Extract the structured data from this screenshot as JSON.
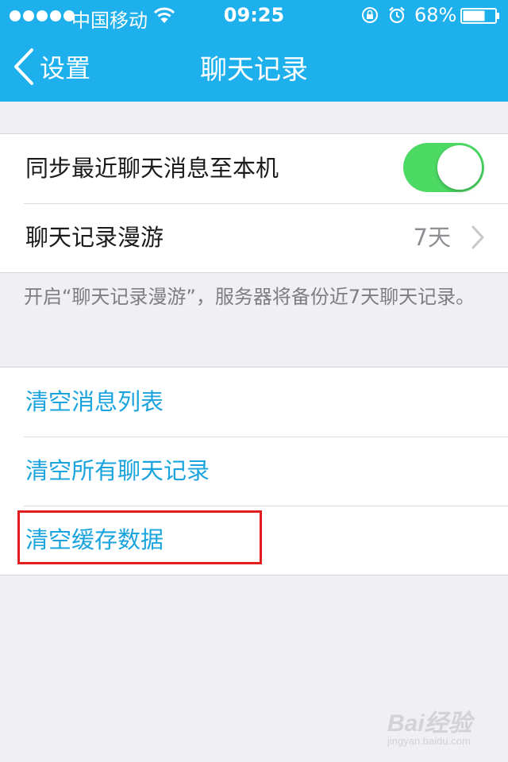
{
  "status_bar": {
    "carrier": "中国移动",
    "time": "09:25",
    "battery": "68%"
  },
  "nav": {
    "back_label": "设置",
    "title": "聊天记录"
  },
  "settings": {
    "sync_label": "同步最近聊天消息至本机",
    "sync_enabled": true,
    "roaming_label": "聊天记录漫游",
    "roaming_value": "7天",
    "roaming_note": "开启“聊天记录漫游”，服务器将备份近7天聊天记录。"
  },
  "actions": {
    "clear_list": "清空消息列表",
    "clear_all_chats": "清空所有聊天记录",
    "clear_cache": "清空缓存数据"
  },
  "watermark": {
    "brand": "Bai经验",
    "url": "jingyan.baidu.com"
  },
  "colors": {
    "header": "#1eb0ed",
    "link": "#1aa4de",
    "toggle_on": "#4cd964",
    "highlight": "#e21d1d"
  }
}
